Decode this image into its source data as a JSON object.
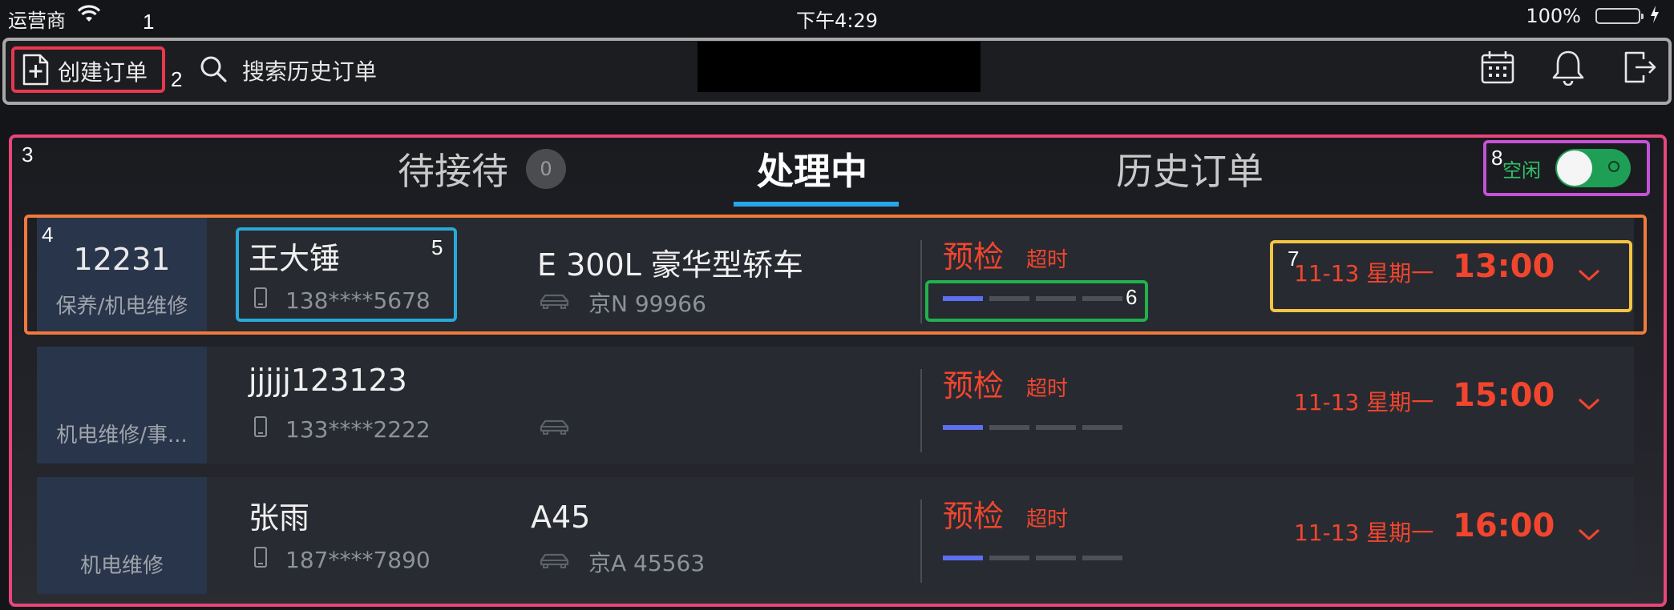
{
  "status_bar": {
    "carrier": "运营商",
    "time": "下午4:29",
    "battery": "100%"
  },
  "toolbar": {
    "create_label": "创建订单",
    "search_label": "搜索历史订单",
    "icons": [
      "calendar-icon",
      "bell-icon",
      "logout-icon"
    ]
  },
  "tabs": [
    {
      "label": "待接待",
      "count": "0"
    },
    {
      "label": "处理中"
    },
    {
      "label": "历史订单"
    }
  ],
  "toggle": {
    "label": "空闲",
    "state": "on"
  },
  "orders": [
    {
      "id": "12231",
      "service": "保养/机电维修",
      "customer": "王大锤",
      "phone": "138****5678",
      "car_model": "E 300L 豪华型轿车",
      "plate": "京N 99966",
      "stage": "预检",
      "overtime": "超时",
      "progress_active": 1,
      "progress_total": 4,
      "date": "11-13 星期一",
      "time": "13:00"
    },
    {
      "id": "",
      "service": "机电维修/事...",
      "customer": "jjjjj123123",
      "phone": "133****2222",
      "car_model": "",
      "plate": "",
      "stage": "预检",
      "overtime": "超时",
      "progress_active": 1,
      "progress_total": 4,
      "date": "11-13 星期一",
      "time": "15:00"
    },
    {
      "id": "",
      "service": "机电维修",
      "customer": "张雨",
      "phone": "187****7890",
      "car_model": "A45",
      "plate": "京A 45563",
      "stage": "预检",
      "overtime": "超时",
      "progress_active": 1,
      "progress_total": 4,
      "date": "11-13 星期一",
      "time": "16:00"
    }
  ],
  "annotations": [
    "1",
    "2",
    "3",
    "4",
    "5",
    "6",
    "7",
    "8"
  ],
  "colors": {
    "accent_red": "#f2452e",
    "tab_underline": "#2aa5e8",
    "toggle_green": "#1f9e55",
    "progress_active": "#5d6ff0"
  }
}
